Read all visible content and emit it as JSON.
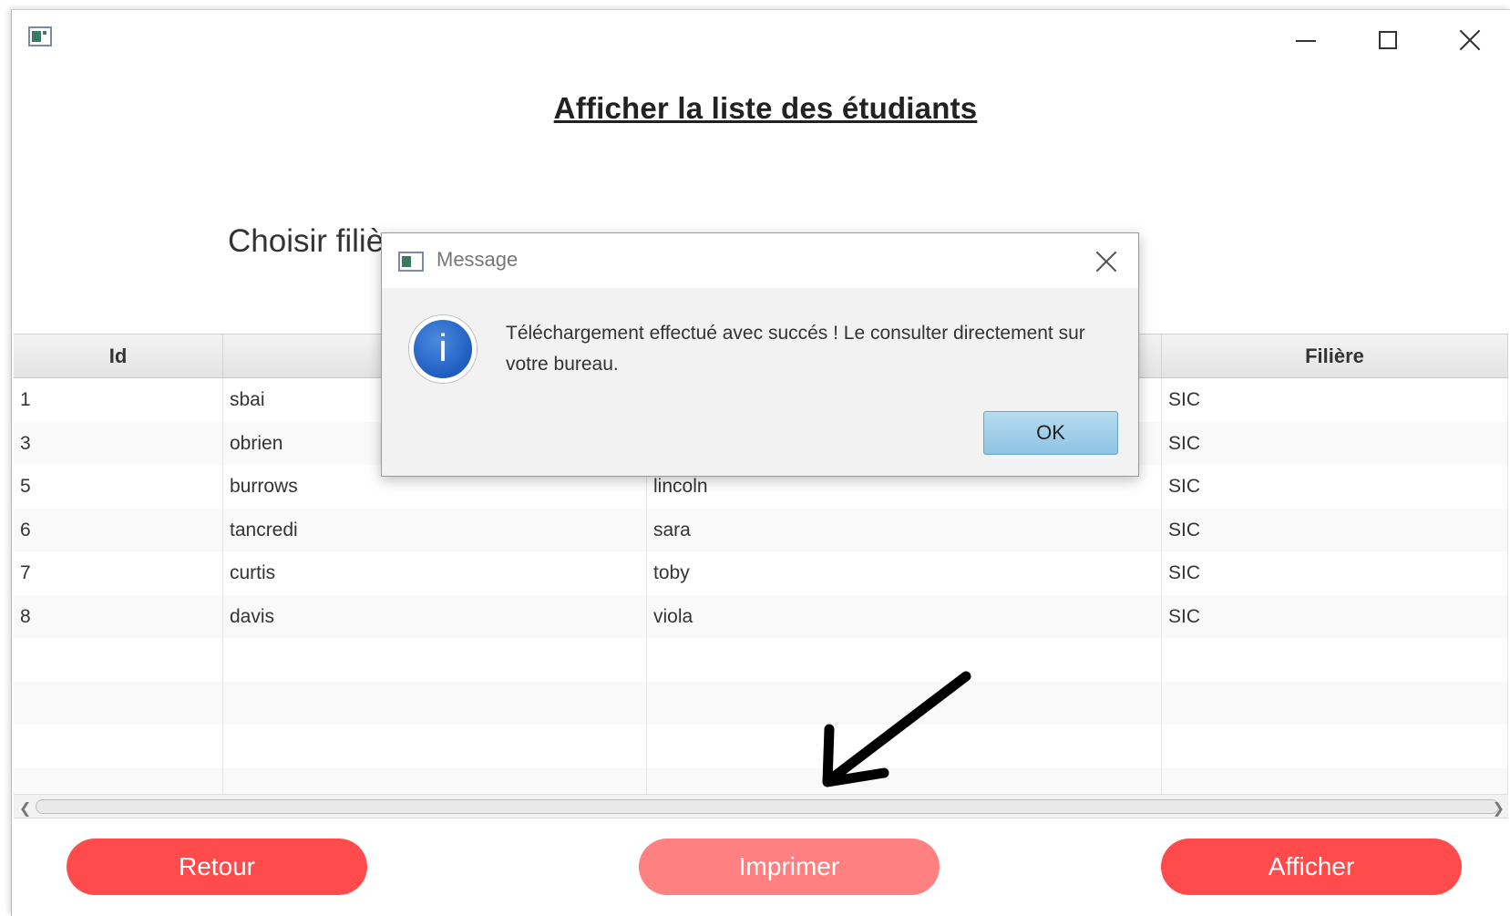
{
  "window": {
    "title": ""
  },
  "page": {
    "title": "Afficher la liste des étudiants",
    "filiere_label": "Choisir filière"
  },
  "table": {
    "columns": [
      "Id",
      "",
      "",
      "Filière"
    ],
    "rows": [
      [
        "1",
        "sbai",
        "",
        "SIC"
      ],
      [
        "3",
        "obrien",
        "",
        "SIC"
      ],
      [
        "5",
        "burrows",
        "lincoln",
        "SIC"
      ],
      [
        "6",
        "tancredi",
        "sara",
        "SIC"
      ],
      [
        "7",
        "curtis",
        "toby",
        "SIC"
      ],
      [
        "8",
        "davis",
        "viola",
        "SIC"
      ]
    ]
  },
  "buttons": {
    "retour": "Retour",
    "imprimer": "Imprimer",
    "afficher": "Afficher"
  },
  "dialog": {
    "title": "Message",
    "icon": "info-icon",
    "message": "Téléchargement effectué avec succés ! Le consulter directement sur votre bureau.",
    "ok": "OK"
  },
  "colors": {
    "button_primary": "#ff4b4b",
    "button_disabled": "#ff8080",
    "ok_button": "#a8d2ec"
  }
}
